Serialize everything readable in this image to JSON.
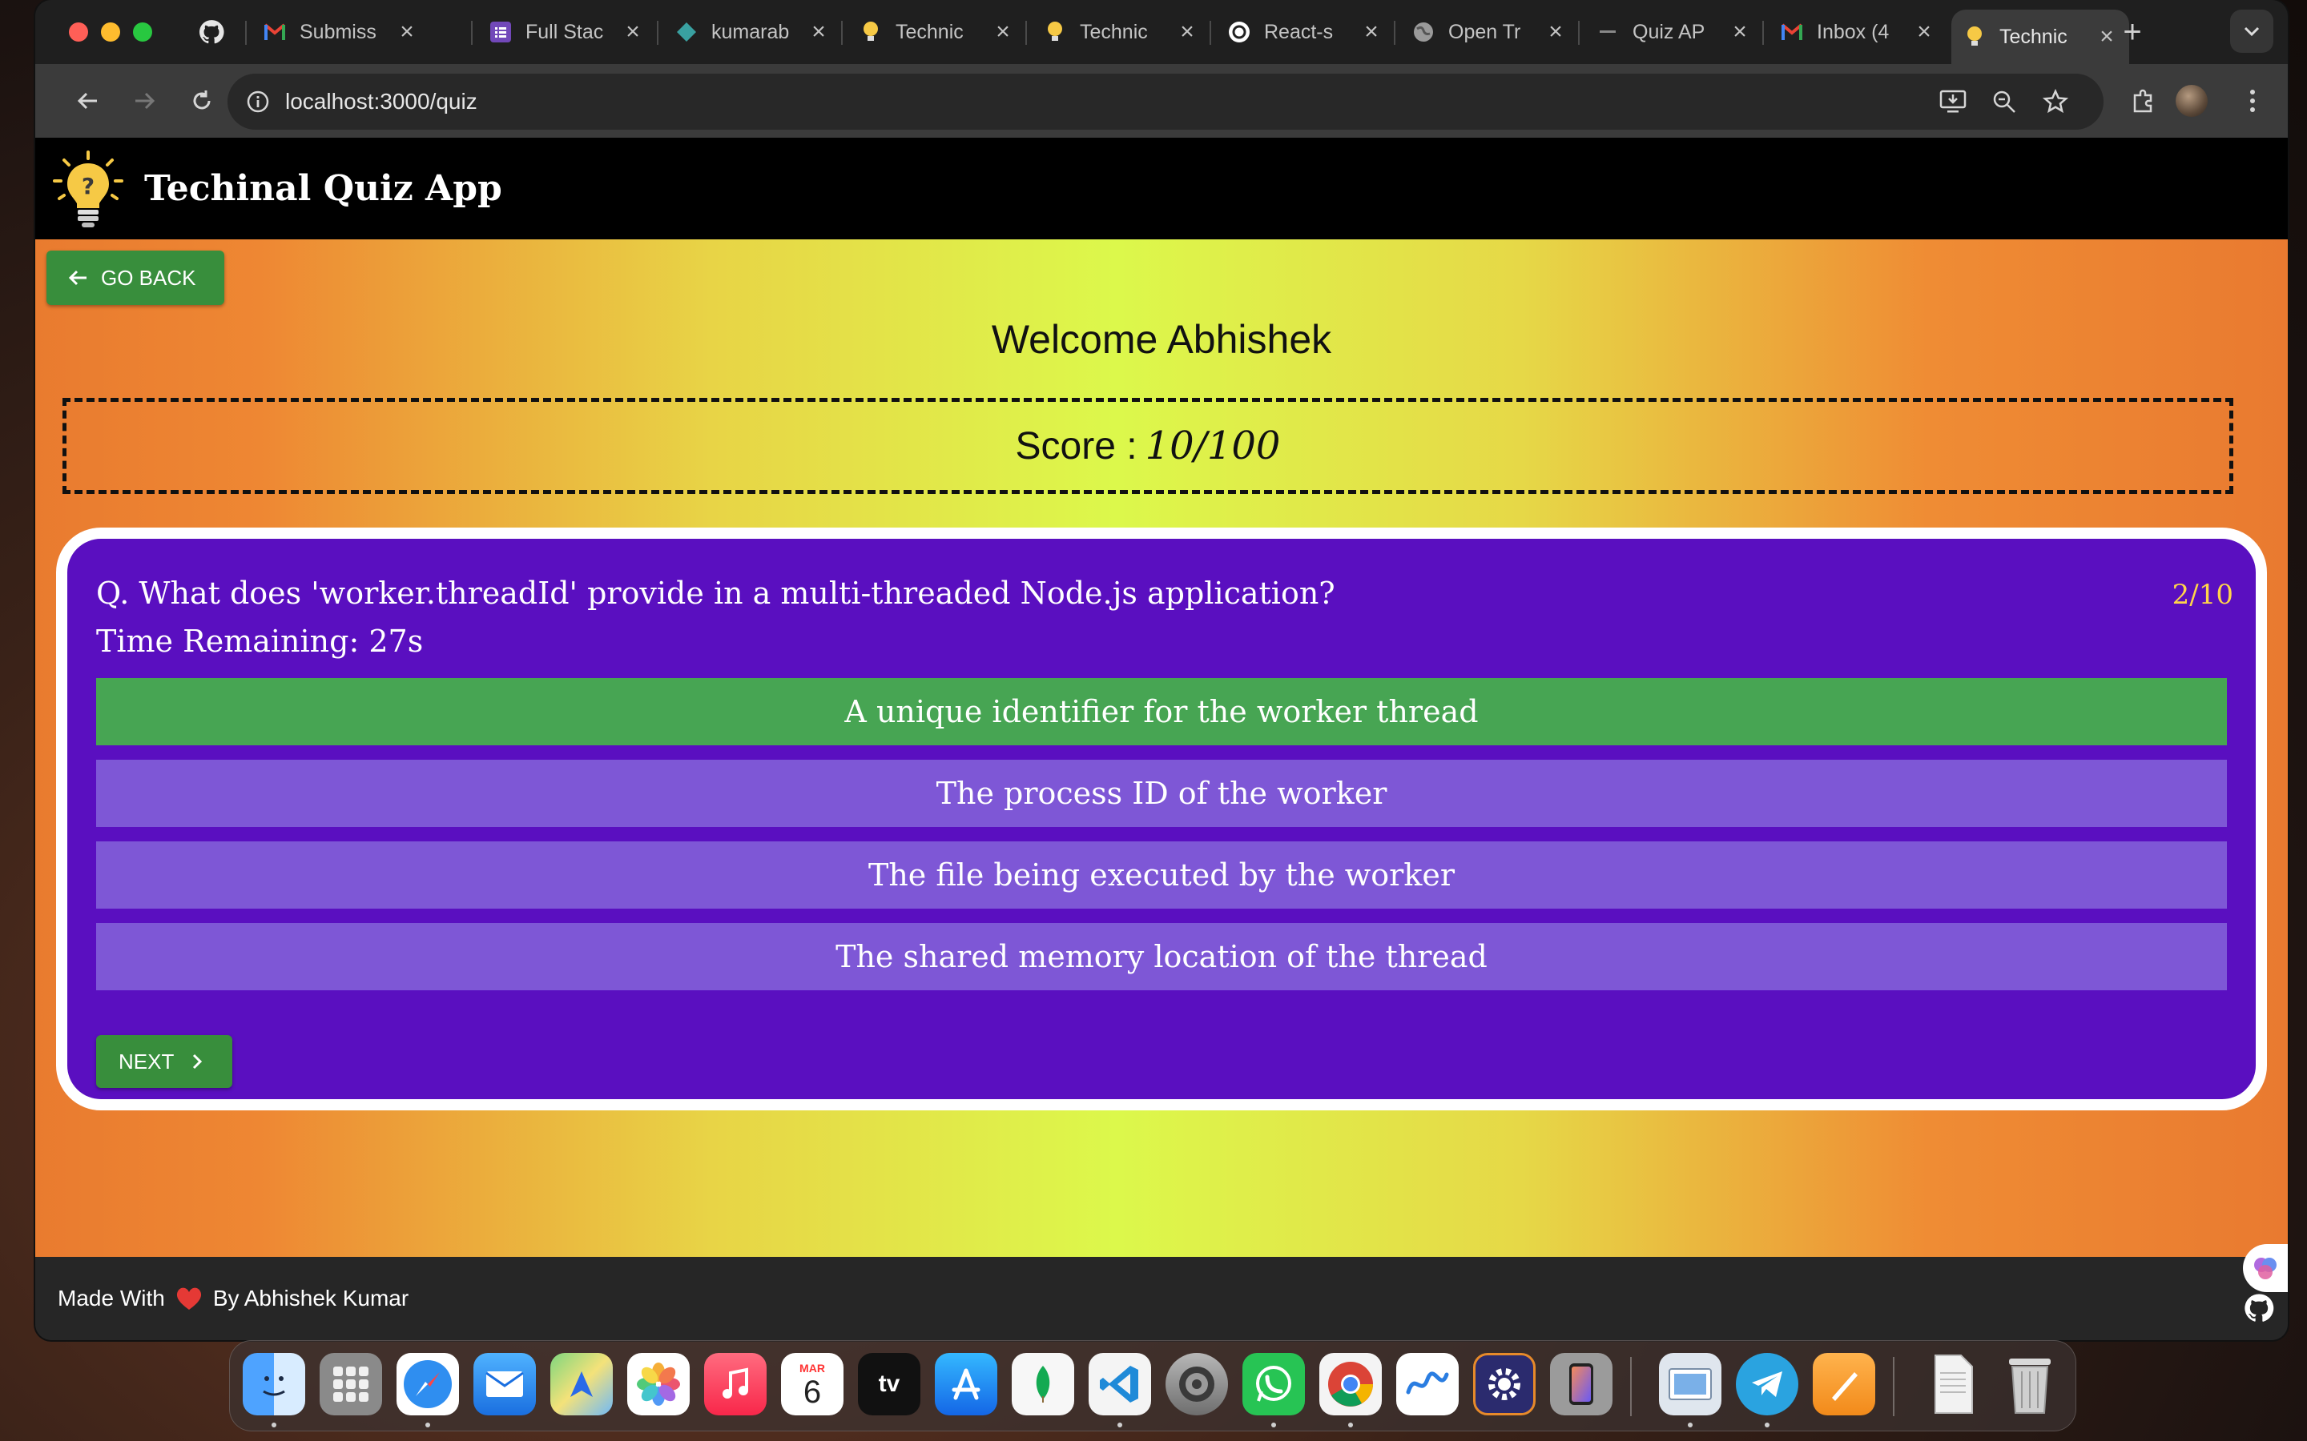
{
  "browser": {
    "tabs": [
      {
        "title": "Submiss",
        "favicon": "gmail-icon"
      },
      {
        "title": "Full Stac",
        "favicon": "forms-icon"
      },
      {
        "title": "kumarab",
        "favicon": "diamond-icon"
      },
      {
        "title": "Technic",
        "favicon": "bulb-icon"
      },
      {
        "title": "Technic",
        "favicon": "bulb-icon"
      },
      {
        "title": "React-s",
        "favicon": "openai-icon"
      },
      {
        "title": "Open Tr",
        "favicon": "globe-icon"
      },
      {
        "title": "Quiz AP",
        "favicon": "dash-icon"
      },
      {
        "title": "Inbox (4",
        "favicon": "gmail-icon"
      },
      {
        "title": "Technic",
        "favicon": "bulb-icon"
      }
    ],
    "active_tab_index": 9,
    "url": "localhost:3000/quiz"
  },
  "app": {
    "title": "Techinal Quiz App",
    "go_back_label": "GO BACK",
    "welcome": "Welcome Abhishek",
    "score_label": "Score :",
    "score_value": "10/100",
    "question": "Q. What does 'worker.threadId' provide in a multi-threaded Node.js application?",
    "counter": "2/10",
    "timer": "Time Remaining: 27s",
    "options": [
      {
        "text": "A unique identifier for the worker thread",
        "state": "correct"
      },
      {
        "text": "The process ID of the worker",
        "state": "default"
      },
      {
        "text": "The file being executed by the worker",
        "state": "default"
      },
      {
        "text": "The shared memory location of the thread",
        "state": "default"
      }
    ],
    "next_label": "NEXT",
    "footer_made_with": "Made With",
    "footer_by": "By Abhishek Kumar"
  },
  "dock": {
    "calendar_month": "MAR",
    "calendar_day": "6",
    "tv_label": "tv"
  },
  "colors": {
    "appbar": "#000000",
    "card": "#5a0fc0",
    "option_default": "#7e57d6",
    "option_correct": "#47a553",
    "button_green": "#388e3c",
    "counter": "#ffd54a"
  }
}
